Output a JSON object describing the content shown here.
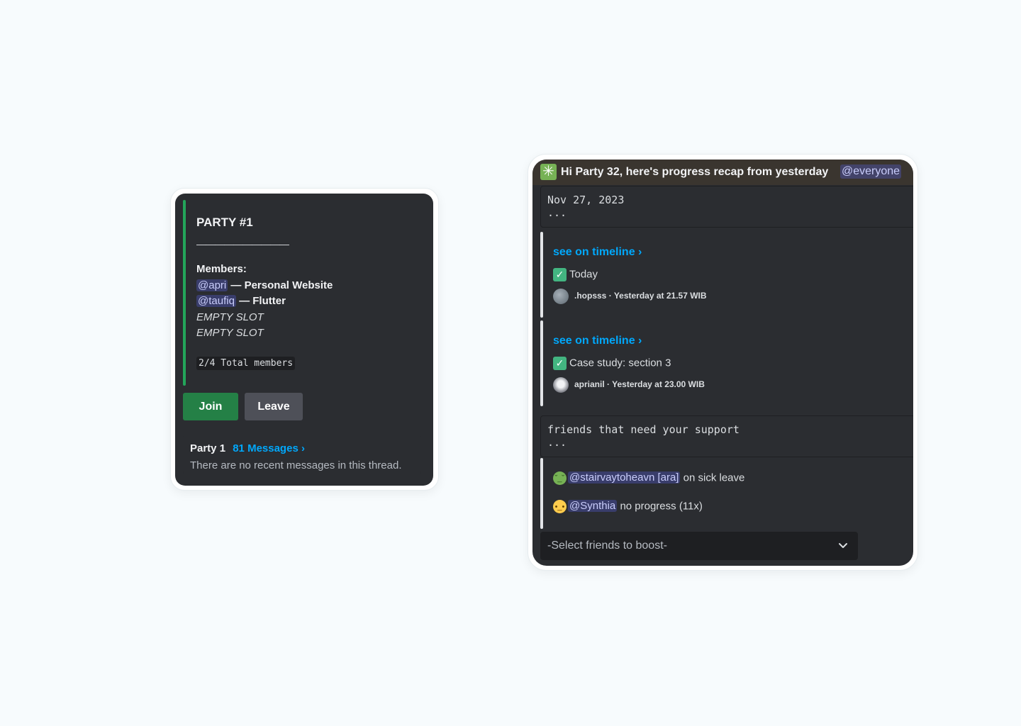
{
  "party_card": {
    "title": "PARTY #1",
    "divider": "——————————",
    "members_label": "Members:",
    "members": [
      {
        "mention": "@apri",
        "role": "— Personal Website"
      },
      {
        "mention": "@taufiq",
        "role": "— Flutter"
      }
    ],
    "empty_slots": [
      "EMPTY SLOT",
      "EMPTY SLOT"
    ],
    "total": "2/4 Total members",
    "join_label": "Join",
    "leave_label": "Leave",
    "thread": {
      "name": "Party 1",
      "messages_link": "81 Messages ›",
      "status": "There are no recent messages in this thread."
    },
    "colors": {
      "accent_bar": "#23a55a",
      "join": "#248046",
      "leave": "#4e5058"
    }
  },
  "recap_card": {
    "header_text": "Hi Party 32, here's progress recap from yesterday",
    "header_icon": "sparkle-icon",
    "header_mention": "@everyone",
    "date_block": {
      "line1": "Nov 27, 2023",
      "line2": "..."
    },
    "timeline_entries": [
      {
        "link": "see on timeline ›",
        "task": "Today",
        "author": ".hopsss",
        "timestamp": "· Yesterday at 21.57 WIB"
      },
      {
        "link": "see on timeline ›",
        "task": "Case study: section 3",
        "author": "aprianil",
        "timestamp": "· Yesterday at 23.00 WIB"
      }
    ],
    "support_block": {
      "line1": "friends that need your support",
      "line2": "..."
    },
    "support_entries": [
      {
        "icon": "sick-face-icon",
        "mention": "@stairvaytoheavn [ara]",
        "status": "on sick leave"
      },
      {
        "icon": "neutral-face-icon",
        "mention": "@Synthia",
        "status": "no progress (11x)"
      }
    ],
    "select_placeholder": "-Select friends to boost-"
  }
}
